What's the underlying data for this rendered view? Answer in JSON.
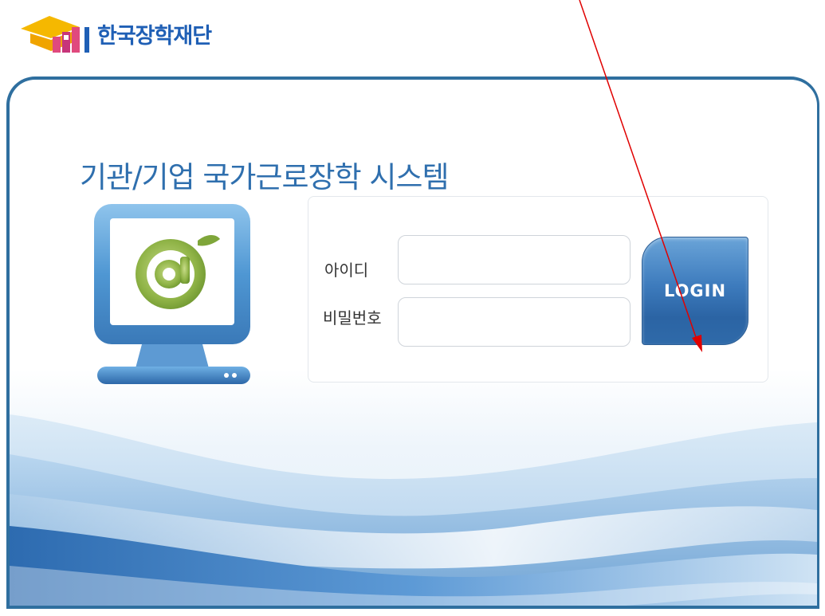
{
  "brand": {
    "name": "한국장학재단"
  },
  "page": {
    "title": "기관/기업 국가근로장학 시스템"
  },
  "login": {
    "id_label": "아이디",
    "password_label": "비밀번호",
    "id_value": "",
    "password_value": "",
    "button_label": "LOGIN"
  },
  "colors": {
    "brand_blue": "#1f5fb5",
    "title_blue": "#2f6fae",
    "panel_border": "#2f6f9f",
    "button_blue": "#3d7bbd",
    "annotation_arrow": "#e00000"
  },
  "icons": {
    "brand_logo": "graduation-cap-logo-icon",
    "monitor": "monitor-at-sign-icon",
    "annotation": "red-arrow-icon"
  }
}
